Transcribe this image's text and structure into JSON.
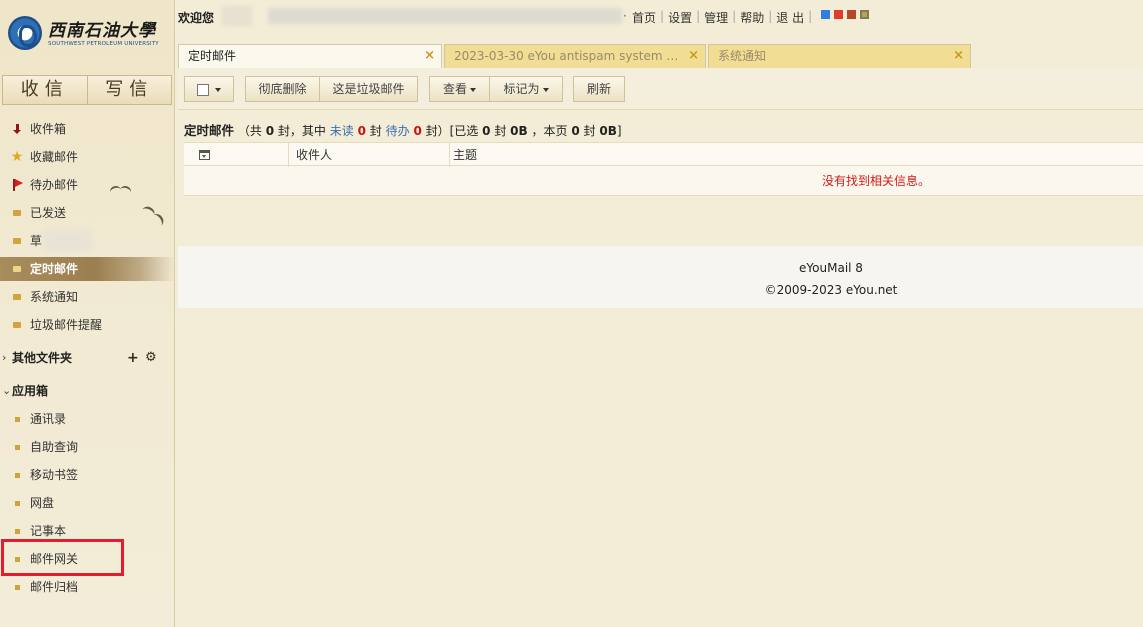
{
  "logo": {
    "name_cn": "西南石油大學",
    "name_en": "SOUTHWEST PETROLEUM UNIVERSITY"
  },
  "mail_buttons": {
    "receive": "收信",
    "compose": "写信"
  },
  "folders": [
    {
      "label": "收件箱",
      "icon": "inbox-arrow-icon"
    },
    {
      "label": "收藏邮件",
      "icon": "star-icon"
    },
    {
      "label": "待办邮件",
      "icon": "flag-icon"
    },
    {
      "label": "已发送",
      "icon": "folder-icon"
    },
    {
      "label": "草",
      "icon": "folder-icon"
    },
    {
      "label": "定时邮件",
      "icon": "folder-icon",
      "active": true
    },
    {
      "label": "系统通知",
      "icon": "folder-icon"
    },
    {
      "label": "垃圾邮件提醒",
      "icon": "folder-icon"
    }
  ],
  "other_folders": {
    "label": "其他文件夹",
    "caret": "›",
    "add_icon": "+",
    "settings_icon": "⚙"
  },
  "apps": {
    "label": "应用箱",
    "caret": "⌄",
    "items": [
      "通讯录",
      "自助查询",
      "移动书签",
      "网盘",
      "记事本",
      "邮件网关",
      "邮件归档"
    ]
  },
  "topbar": {
    "welcome": "欢迎您",
    "dot": "·",
    "links": [
      "首页",
      "设置",
      "管理",
      "帮助",
      "退 出"
    ],
    "skin_colors": [
      "#2f7fe0",
      "#e23b2e",
      "#b5472a",
      "#b8a16a"
    ]
  },
  "tabs": [
    {
      "label": "定时邮件",
      "active": true
    },
    {
      "label": "2023-03-30 eYou antispam system no...",
      "active": false
    },
    {
      "label": "系统通知",
      "active": false
    }
  ],
  "tab_close": "×",
  "toolbar": {
    "delete_forever": "彻底删除",
    "mark_spam": "这是垃圾邮件",
    "view": "查看",
    "mark_as": "标记为",
    "refresh": "刷新"
  },
  "summary": {
    "title": "定时邮件",
    "total_pre": "（共",
    "total": "0",
    "total_mid": "封，其中",
    "unread_label": "未读",
    "unread": "0",
    "unread_unit": "封",
    "todo_label": "待办",
    "todo": "0",
    "todo_unit": "封）[已选",
    "selected": "0",
    "selected_mid": "封",
    "selected_size": "0B",
    "page_pre": "，本页",
    "page_count": "0",
    "page_mid": "封",
    "page_size": "0B",
    "close": "]"
  },
  "table": {
    "columns": [
      "收件人",
      "主题"
    ],
    "empty_message": "没有找到相关信息。"
  },
  "footer": {
    "product": "eYouMail 8",
    "copyright": "©2009-2023 eYou.net"
  }
}
